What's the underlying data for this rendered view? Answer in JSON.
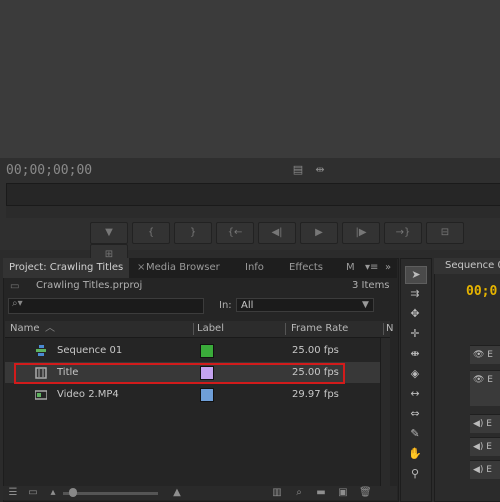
{
  "monitor": {
    "timecode": "00;00;00;00",
    "icons": [
      "clip-icon",
      "marker-icon"
    ]
  },
  "transport": {
    "buttons": [
      "add-marker-icon",
      "mark-in-icon",
      "mark-out-icon",
      "go-to-in-icon",
      "step-back-icon",
      "play-icon",
      "step-forward-icon",
      "go-to-out-icon",
      "insert-icon",
      "overwrite-icon"
    ]
  },
  "project_panel": {
    "tabs": [
      {
        "label": "Project: Crawling Titles",
        "active": true
      },
      {
        "label": "Media Browser",
        "active": false
      },
      {
        "label": "Info",
        "active": false
      },
      {
        "label": "Effects",
        "active": false
      },
      {
        "label": "M",
        "active": false
      }
    ],
    "project_file": "Crawling Titles.prproj",
    "item_count": "3 Items",
    "in_label": "In:",
    "in_value": "All",
    "columns": {
      "name": "Name",
      "label": "Label",
      "frame_rate": "Frame Rate",
      "extra": "N"
    },
    "items": [
      {
        "name": "Sequence 01",
        "icon": "sequence-icon",
        "label_color": "#3aab3a",
        "fps": "25.00 fps",
        "selected": false
      },
      {
        "name": "Title",
        "icon": "title-icon",
        "label_color": "#c5a3f0",
        "fps": "25.00 fps",
        "selected": true
      },
      {
        "name": "Video 2.MP4",
        "icon": "video-clip-icon",
        "label_color": "#6f9fd8",
        "fps": "29.97 fps",
        "selected": false
      }
    ],
    "highlight_color": "#d21b1b"
  },
  "tools": [
    "selection-tool-icon",
    "track-select-icon",
    "ripple-edit-icon",
    "rolling-edit-icon",
    "rate-stretch-icon",
    "razor-icon",
    "slip-icon",
    "slide-icon",
    "pen-icon",
    "hand-icon",
    "zoom-icon"
  ],
  "timeline": {
    "tab_label": "Sequence 0",
    "timecode": "00;0"
  }
}
